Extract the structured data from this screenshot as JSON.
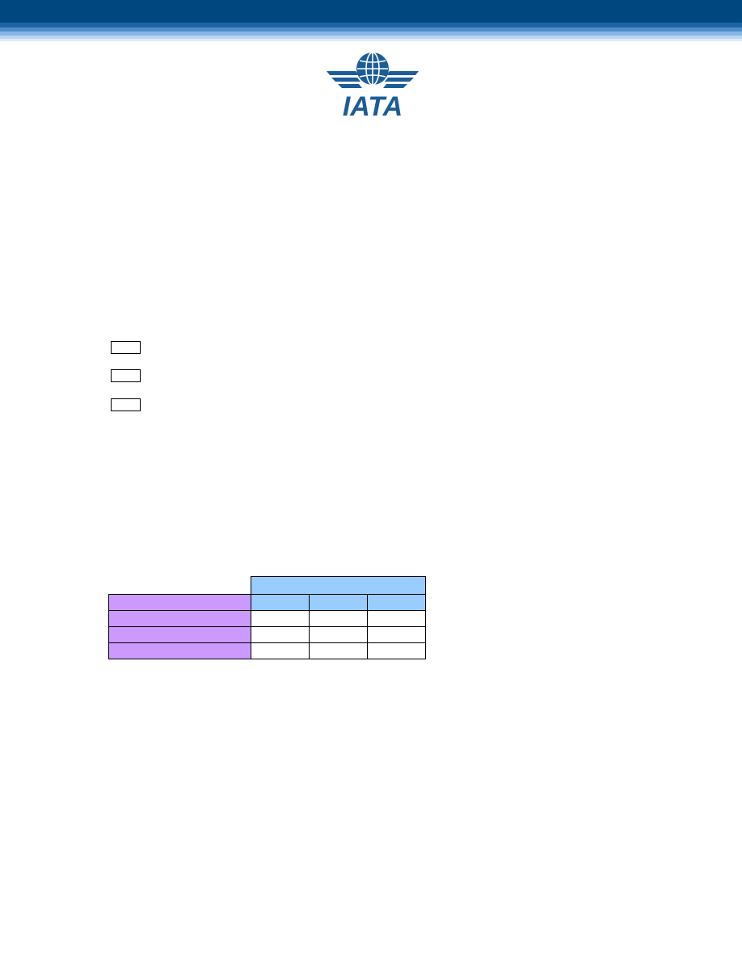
{
  "header": {
    "logo": {
      "icon": "iata-globe-wings-logo",
      "text": "IATA",
      "color": "#1c5c98"
    },
    "band_colors": [
      "#00467f",
      "#1d64a3",
      "#4f8ccb",
      "#86b6e3",
      "#b9d6f1",
      "#dcebf9"
    ]
  },
  "checkboxes": [
    {
      "checked": false
    },
    {
      "checked": false
    },
    {
      "checked": false
    }
  ],
  "table": {
    "header_color": "#99ccff",
    "row_label_color": "#cc99ff",
    "group_header": "",
    "column_headers": [
      "",
      "",
      ""
    ],
    "rows": [
      {
        "label": "",
        "cells": [
          "",
          "",
          ""
        ]
      },
      {
        "label": "",
        "cells": [
          "",
          "",
          ""
        ]
      },
      {
        "label": "",
        "cells": [
          "",
          "",
          ""
        ]
      }
    ]
  }
}
